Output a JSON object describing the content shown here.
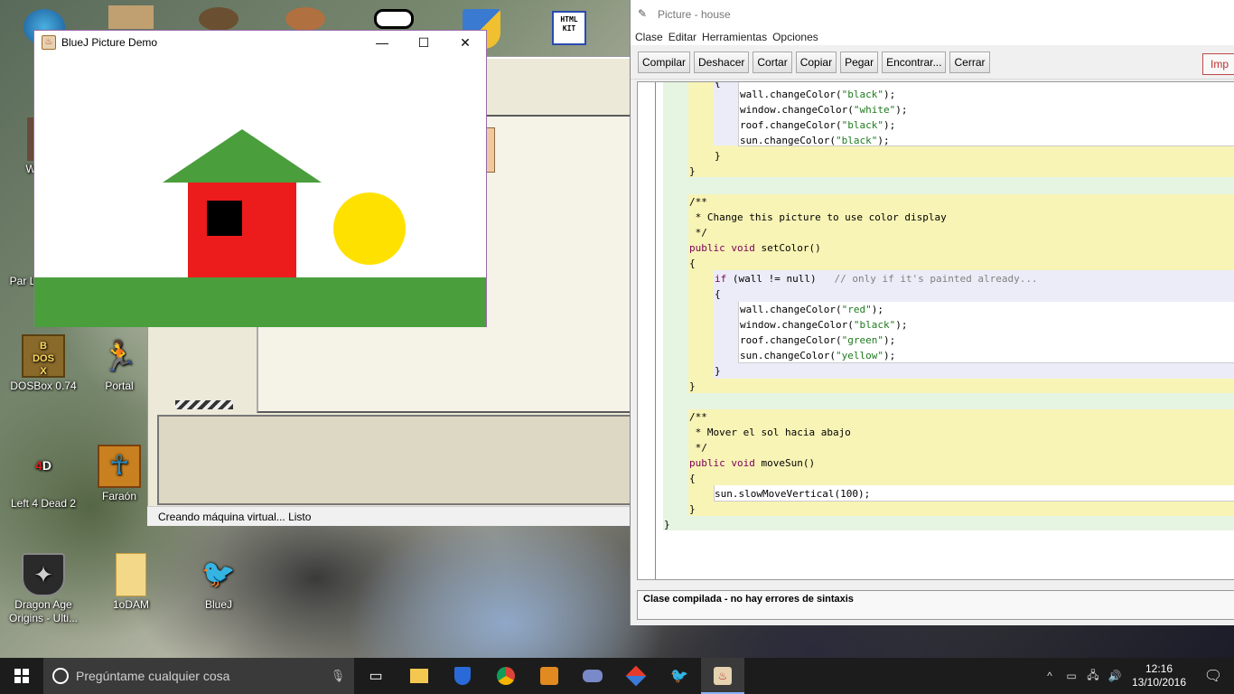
{
  "desktop": {
    "icons": [
      {
        "id": "dosbox",
        "label": "DOSBox 0.74"
      },
      {
        "id": "portal",
        "label": "Portal"
      },
      {
        "id": "left4dead",
        "label": "Left 4 Dead 2"
      },
      {
        "id": "faraon",
        "label": "Faraón"
      },
      {
        "id": "dragonage",
        "label": "Dragon Age Origins - Ulti..."
      },
      {
        "id": "1odam",
        "label": "1oDAM"
      },
      {
        "id": "bluej",
        "label": "BlueJ"
      },
      {
        "id": "partial1",
        "label": "Wa"
      },
      {
        "id": "partial2",
        "label": "Par La"
      }
    ],
    "html_kit_label": "HTML KIT"
  },
  "demo_window": {
    "title": "BlueJ Picture Demo",
    "colors": {
      "roof": "#4a9e3c",
      "wall": "#ec1c1c",
      "window": "#000000",
      "sun": "#ffe100",
      "ground": "#4a9e3c"
    }
  },
  "bluej_main": {
    "status": "Creando máquina virtual... Listo"
  },
  "editor": {
    "title": "Picture - house",
    "menu": [
      "Clase",
      "Editar",
      "Herramientas",
      "Opciones"
    ],
    "toolbar": [
      "Compilar",
      "Deshacer",
      "Cortar",
      "Copiar",
      "Pegar",
      "Encontrar...",
      "Cerrar"
    ],
    "toolbar_right": "Imp",
    "status": "Clase compilada - no hay errores de sintaxis",
    "code": {
      "l1": "wall.changeColor(\"black\");",
      "l2": "window.changeColor(\"white\");",
      "l3": "roof.changeColor(\"black\");",
      "l4": "sun.changeColor(\"black\");",
      "c1": "/**",
      "c2": " * Change this picture to use color display",
      "c3": " */",
      "sig_setcolor_name": "setColor()",
      "if_cond": "(wall != null)",
      "if_comment": "// only if it's painted already...",
      "s1": "wall.changeColor(\"red\");",
      "s2": "window.changeColor(\"black\");",
      "s3": "roof.changeColor(\"green\");",
      "s4": "sun.changeColor(\"yellow\");",
      "m1": "/**",
      "m2": " * Mover el sol hacia abajo",
      "m3": " */",
      "sig_movesun_name": "moveSun()",
      "mv": "sun.slowMoveVertical(100);",
      "kw_public": "public",
      "kw_void": "void",
      "kw_if": "if",
      "kw_null": "null"
    }
  },
  "taskbar": {
    "search_placeholder": "Pregúntame cualquier cosa",
    "time": "12:16",
    "date": "13/10/2016"
  }
}
